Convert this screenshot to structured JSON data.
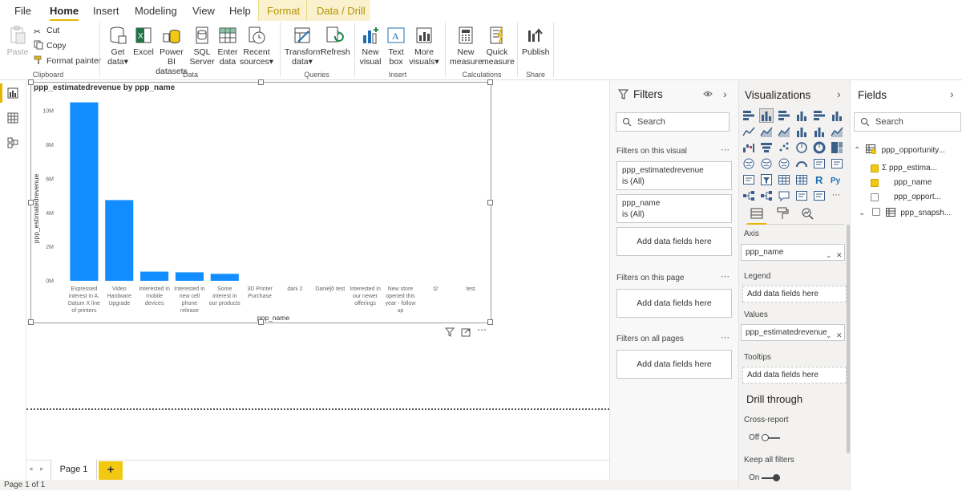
{
  "menu": {
    "file": "File",
    "home": "Home",
    "insert": "Insert",
    "modeling": "Modeling",
    "view": "View",
    "help": "Help",
    "format": "Format",
    "data_drill": "Data / Drill"
  },
  "ribbon": {
    "clipboard": {
      "paste": "Paste",
      "cut": "Cut",
      "copy": "Copy",
      "format_painter": "Format painter",
      "label": "Clipboard"
    },
    "data": {
      "get_data": [
        "Get",
        "data"
      ],
      "excel": "Excel",
      "power_bi": [
        "Power BI",
        "datasets"
      ],
      "sql": [
        "SQL",
        "Server"
      ],
      "enter": [
        "Enter",
        "data"
      ],
      "recent": [
        "Recent",
        "sources"
      ],
      "label": "Data"
    },
    "queries": {
      "transform": [
        "Transform",
        "data"
      ],
      "refresh": "Refresh",
      "label": "Queries"
    },
    "insert": {
      "new_visual": [
        "New",
        "visual"
      ],
      "text_box": [
        "Text",
        "box"
      ],
      "more_visuals": [
        "More",
        "visuals"
      ],
      "label": "Insert"
    },
    "calculations": {
      "new_measure": [
        "New",
        "measure"
      ],
      "quick_measure": [
        "Quick",
        "measure"
      ],
      "label": "Calculations"
    },
    "share": {
      "publish": "Publish",
      "label": "Share"
    }
  },
  "colors": {
    "accent": "#e8b600",
    "bar": "#118dff",
    "format_tab": "#faf2cf"
  },
  "chart_data": {
    "type": "bar",
    "title": "ppp_estimatedrevenue by ppp_name",
    "xlabel": "ppp_name",
    "ylabel": "ppp_estimatedrevenue",
    "ylim": [
      0,
      11000000
    ],
    "yticks": [
      {
        "value": 0,
        "label": "0M"
      },
      {
        "value": 2000000,
        "label": "2M"
      },
      {
        "value": 4000000,
        "label": "4M"
      },
      {
        "value": 6000000,
        "label": "6M"
      },
      {
        "value": 8000000,
        "label": "8M"
      },
      {
        "value": 10000000,
        "label": "10M"
      }
    ],
    "categories": [
      [
        "Expressed",
        "interest in A.",
        "Datum X line",
        "of printers"
      ],
      [
        "Video",
        "Hardware",
        "Upgrade"
      ],
      [
        "Interested in",
        "mobile",
        "devices"
      ],
      [
        "Interested in",
        "new cell",
        "phone",
        "release"
      ],
      [
        "Some",
        "interest in",
        "our products"
      ],
      [
        "3D Printer",
        "Purchase"
      ],
      [
        "dani 2"
      ],
      [
        "Danieĵô test"
      ],
      [
        "Interested in",
        "our newer",
        "offerings"
      ],
      [
        "New store",
        "opened this",
        "year - follow",
        "up"
      ],
      [
        "t2"
      ],
      [
        "test"
      ]
    ],
    "values": [
      10500000,
      4750000,
      540000,
      500000,
      410000,
      0,
      0,
      0,
      0,
      0,
      0,
      0
    ],
    "grid": false,
    "legend": "none"
  },
  "filters": {
    "title": "Filters",
    "search_placeholder": "Search",
    "on_visual_label": "Filters on this visual",
    "on_page_label": "Filters on this page",
    "on_all_label": "Filters on all pages",
    "cards": [
      {
        "field": "ppp_estimatedrevenue",
        "state": "is (All)"
      },
      {
        "field": "ppp_name",
        "state": "is (All)"
      }
    ],
    "add_fields": "Add data fields here"
  },
  "visualizations": {
    "title": "Visualizations",
    "axis_label": "Axis",
    "axis_value": "ppp_name",
    "legend_label": "Legend",
    "values_label": "Values",
    "values_value": "ppp_estimatedrevenue",
    "tooltips_label": "Tooltips",
    "add_fields": "Add data fields here",
    "drill_through": "Drill through",
    "cross_report": "Cross-report",
    "cross_report_state": "Off",
    "keep_filters": "Keep all filters",
    "keep_filters_state": "On"
  },
  "fields": {
    "title": "Fields",
    "search_placeholder": "Search",
    "table1": "ppp_opportunity...",
    "items": [
      {
        "name": "ppp_estima...",
        "checked": true,
        "sigma": true
      },
      {
        "name": "ppp_name",
        "checked": true,
        "sigma": false
      },
      {
        "name": "ppp_opport...",
        "checked": false,
        "sigma": false
      }
    ],
    "table2": "ppp_snapsh..."
  },
  "pages": {
    "tab": "Page 1",
    "add": "+"
  },
  "status": {
    "text": "Page 1 of 1"
  }
}
